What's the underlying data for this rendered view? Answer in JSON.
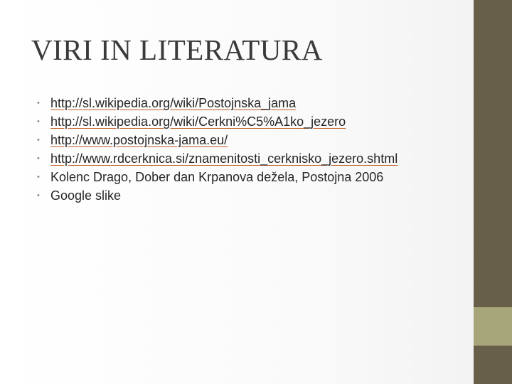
{
  "slide": {
    "title": "VIRI IN LITERATURA",
    "bullet_glyph": "•",
    "items": [
      {
        "text": "http://sl.wikipedia.org/wiki/Postojnska_jama",
        "is_link": true
      },
      {
        "text": "http://sl.wikipedia.org/wiki/Cerkni%C5%A1ko_jezero",
        "is_link": true
      },
      {
        "text": "http://www.postojnska-jama.eu/",
        "is_link": true
      },
      {
        "text": "http://www.rdcerknica.si/znamenitosti_cerknisko_jezero.shtml",
        "is_link": true
      },
      {
        "text": "Kolenc Drago, Dober dan Krpanova dežela, Postojna 2006",
        "is_link": false
      },
      {
        "text": "Google slike",
        "is_link": false
      }
    ]
  },
  "colors": {
    "sidebar_dark": "#675f4a",
    "sidebar_accent": "#a7a67a",
    "link_underline": "#c05a20",
    "text": "#262626"
  }
}
